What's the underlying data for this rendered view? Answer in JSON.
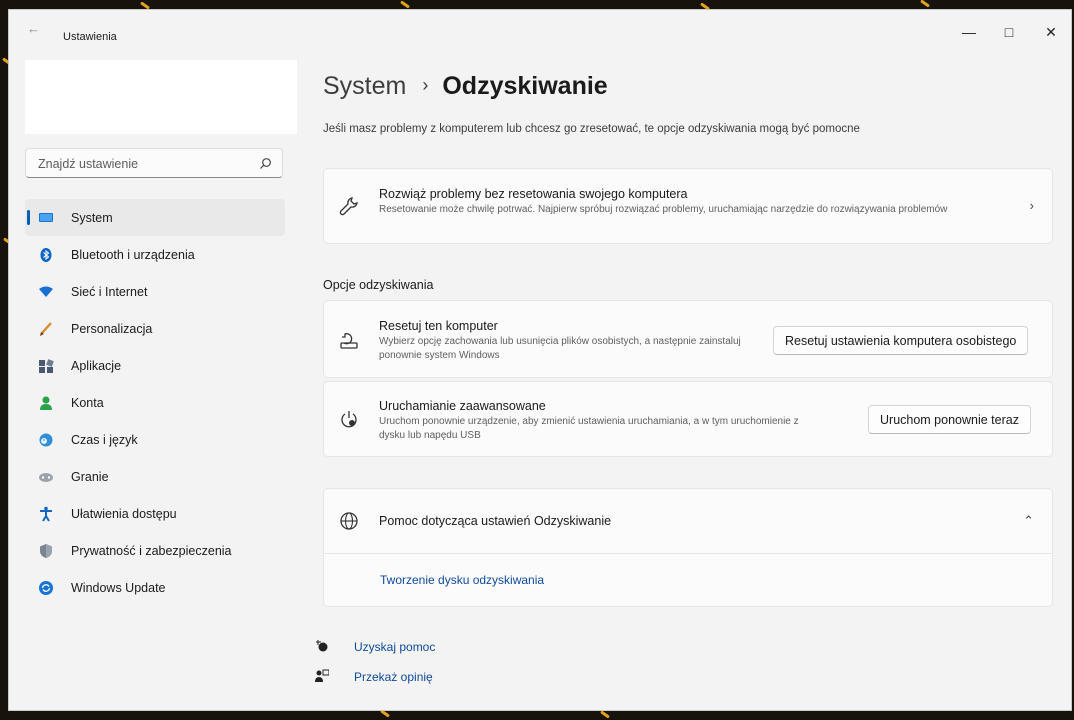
{
  "app": {
    "title": "Ustawienia"
  },
  "search": {
    "placeholder": "Znajdź ustawienie"
  },
  "sidebar": {
    "items": [
      {
        "label": "System",
        "icon": "display-icon"
      },
      {
        "label": "Bluetooth i urządzenia",
        "icon": "bluetooth-icon"
      },
      {
        "label": "Sieć i Internet",
        "icon": "wifi-icon"
      },
      {
        "label": "Personalizacja",
        "icon": "brush-icon"
      },
      {
        "label": "Aplikacje",
        "icon": "apps-icon"
      },
      {
        "label": "Konta",
        "icon": "person-icon"
      },
      {
        "label": "Czas i język",
        "icon": "globe-clock-icon"
      },
      {
        "label": "Granie",
        "icon": "gamepad-icon"
      },
      {
        "label": "Ułatwienia dostępu",
        "icon": "accessibility-icon"
      },
      {
        "label": "Prywatność i zabezpieczenia",
        "icon": "shield-icon"
      },
      {
        "label": "Windows Update",
        "icon": "update-icon"
      }
    ]
  },
  "page": {
    "breadcrumb_parent": "System",
    "breadcrumb_sep": "›",
    "title": "Odzyskiwanie",
    "subtitle": "Jeśli masz problemy z komputerem lub chcesz go zresetować, te opcje odzyskiwania mogą być pomocne"
  },
  "troubleshoot": {
    "title": "Rozwiąż problemy bez resetowania swojego komputera",
    "description": "Resetowanie może chwilę potrwać. Najpierw spróbuj rozwiązać problemy, uruchamiając narzędzie do rozwiązywania problemów"
  },
  "recovery": {
    "section_title": "Opcje odzyskiwania",
    "reset": {
      "title": "Resetuj ten komputer",
      "description": "Wybierz opcję zachowania lub usunięcia plików osobistych, a następnie zainstaluj ponownie system Windows",
      "button": "Resetuj ustawienia komputera osobistego"
    },
    "advanced": {
      "title": "Uruchamianie zaawansowane",
      "description": "Uruchom ponownie urządzenie, aby zmienić ustawienia uruchamiania, a w tym uruchomienie z dysku lub napędu USB",
      "button": "Uruchom ponownie teraz"
    }
  },
  "help": {
    "title": "Pomoc dotycząca ustawień Odzyskiwanie",
    "link": "Tworzenie dysku odzyskiwania"
  },
  "footer": {
    "get_help": "Uzyskaj pomoc",
    "feedback": "Przekaż opinię"
  },
  "colors": {
    "accent": "#005fb8",
    "annotation_arrow": "#e81123",
    "link": "#0f4a9c"
  }
}
